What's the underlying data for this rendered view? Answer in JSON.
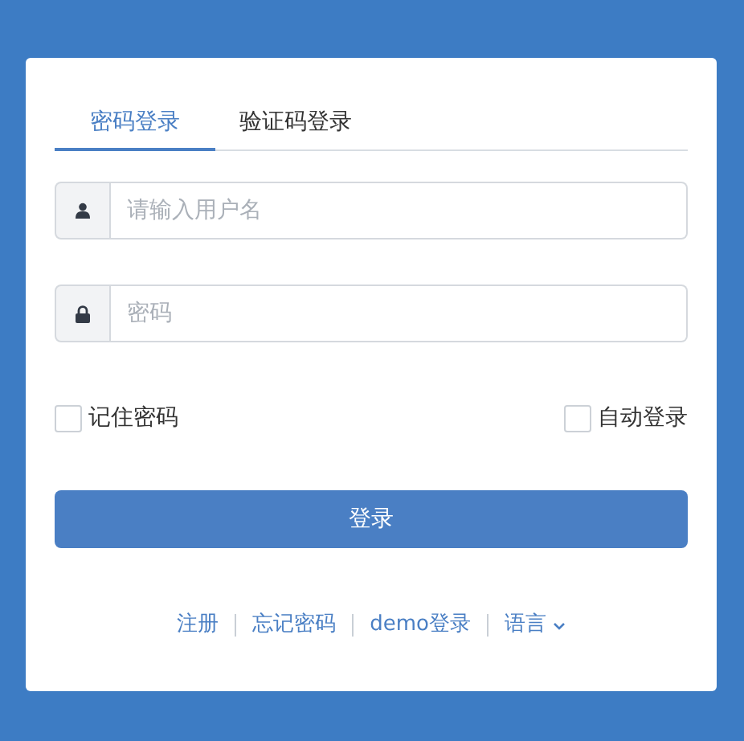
{
  "tabs": [
    {
      "label": "密码登录",
      "selected": true
    },
    {
      "label": "验证码登录",
      "selected": false
    }
  ],
  "fields": [
    {
      "kind": "user",
      "placeholder": "请输入用户名"
    },
    {
      "kind": "password",
      "placeholder": "密码"
    }
  ],
  "options": [
    {
      "label": "记住密码",
      "checked": false
    },
    {
      "label": "自动登录",
      "checked": false
    }
  ],
  "submit": "登录",
  "links": [
    {
      "label": "注册",
      "dropdown": false
    },
    {
      "label": "忘记密码",
      "dropdown": false
    },
    {
      "label": "demo登录",
      "dropdown": false
    },
    {
      "label": "语言",
      "dropdown": true
    }
  ]
}
